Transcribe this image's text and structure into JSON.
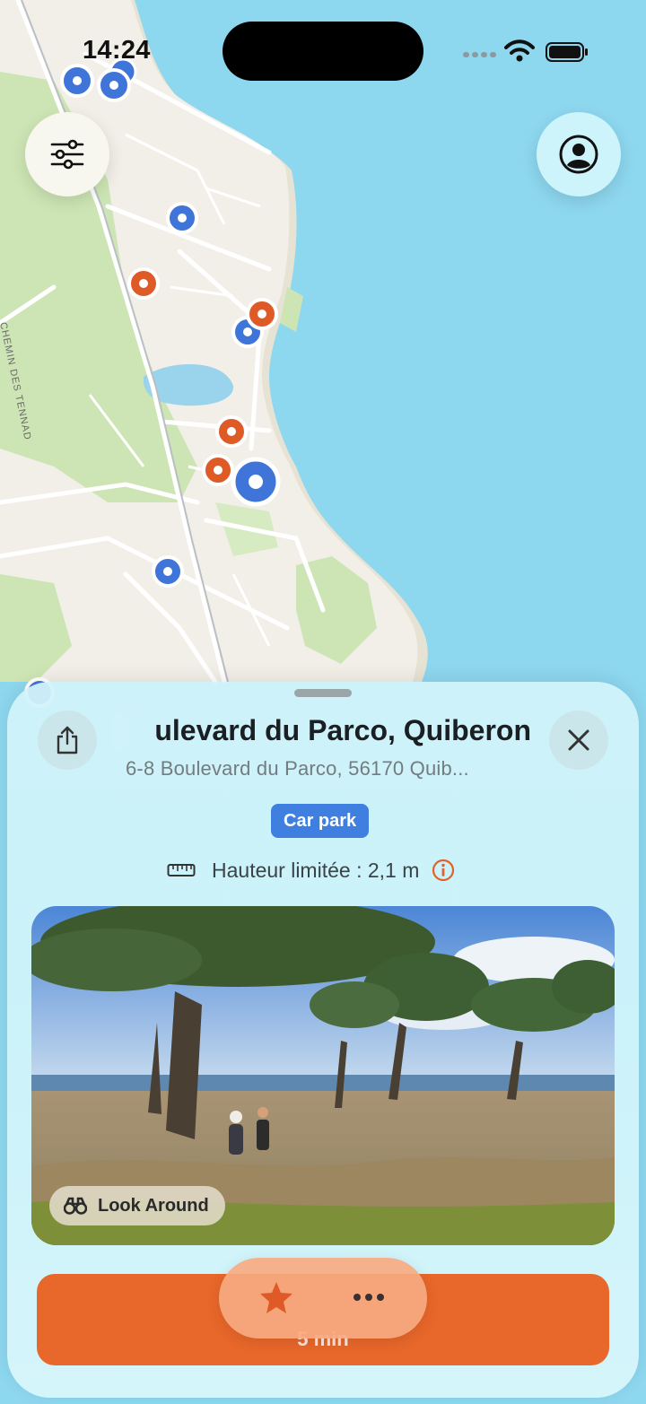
{
  "status_bar": {
    "time": "14:24"
  },
  "map": {
    "road_label": "CHEMIN DES TENNAD",
    "colors": {
      "sea": "#8dd7ef",
      "land": "#f0eee6",
      "park": "#cfe6b7",
      "pin_blue": "#3f74d8",
      "pin_orange": "#de5a26"
    }
  },
  "buttons": {
    "filter_icon": "sliders-icon",
    "profile_icon": "person-circle-icon"
  },
  "place": {
    "title": "ulevard du Parco, Quiberon",
    "address": "6-8 Boulevard du Parco, 56170 Quib...",
    "category": "Car park",
    "height_limit": "Hauteur limitée : 2,1 m",
    "look_around": "Look Around",
    "directions_label": "5 min"
  },
  "colors": {
    "accent_orange": "#e8672a",
    "badge_blue": "#3f7fe0"
  }
}
